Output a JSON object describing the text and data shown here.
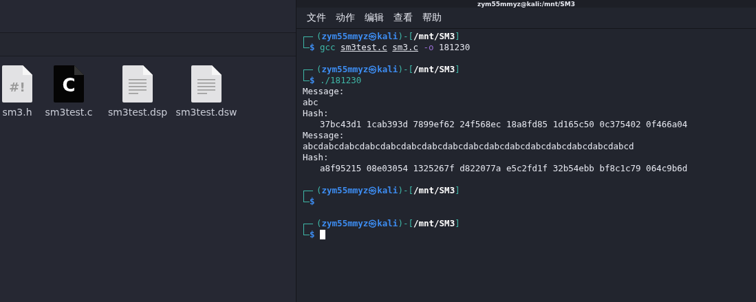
{
  "file_manager": {
    "files": [
      {
        "name": "sm3.h",
        "kind": "script",
        "glyph": "#!"
      },
      {
        "name": "sm3test.c",
        "kind": "c",
        "glyph": "C"
      },
      {
        "name": "sm3test.dsp",
        "kind": "text"
      },
      {
        "name": "sm3test.dsw",
        "kind": "text"
      }
    ]
  },
  "terminal": {
    "title": "zym55mmyz@kali:/mnt/SM3",
    "menu": [
      "文件",
      "动作",
      "编辑",
      "查看",
      "帮助"
    ],
    "entries": [
      {
        "open": "(",
        "user": "zym55mmyz",
        "symbol": "㉿",
        "host": "kali",
        "separator": ")-[",
        "path": "/mnt/SM3",
        "close": "]",
        "prompt_sign": "$",
        "command": [
          {
            "text": "gcc",
            "kind": "program"
          },
          {
            "text": "sm3test.c",
            "kind": "file"
          },
          {
            "text": "sm3.c",
            "kind": "file"
          },
          {
            "text": "-o",
            "kind": "flag"
          },
          {
            "text": "181230",
            "kind": "arg"
          }
        ],
        "cursor": false
      },
      {
        "open": "(",
        "user": "zym55mmyz",
        "symbol": "㉿",
        "host": "kali",
        "separator": ")-[",
        "path": "/mnt/SM3",
        "close": "]",
        "prompt_sign": "$",
        "command": [
          {
            "text": "./181230",
            "kind": "program"
          }
        ],
        "output": [
          {
            "text": "Message:",
            "indent": false
          },
          {
            "text": "abc",
            "indent": false
          },
          {
            "text": "Hash:",
            "indent": false
          },
          {
            "text": "37bc43d1 1cab393d 7899ef62 24f568ec 18a8fd85 1d165c50 0c375402 0f466a04",
            "indent": true
          },
          {
            "text": "Message:",
            "indent": false
          },
          {
            "text": "abcdabcdabcdabcdabcdabcdabcdabcdabcdabcdabcdabcdabcdabcdabcdabcd",
            "indent": false
          },
          {
            "text": "Hash:",
            "indent": false
          },
          {
            "text": "a8f95215 08e03054 1325267f d822077a e5c2fd1f 32b54ebb bf8c1c79 064c9b6d",
            "indent": true
          }
        ],
        "cursor": false
      },
      {
        "open": "(",
        "user": "zym55mmyz",
        "symbol": "㉿",
        "host": "kali",
        "separator": ")-[",
        "path": "/mnt/SM3",
        "close": "]",
        "prompt_sign": "$",
        "cursor": false
      },
      {
        "open": "(",
        "user": "zym55mmyz",
        "symbol": "㉿",
        "host": "kali",
        "separator": ")-[",
        "path": "/mnt/SM3",
        "close": "]",
        "prompt_sign": "$",
        "cursor": true
      }
    ]
  }
}
